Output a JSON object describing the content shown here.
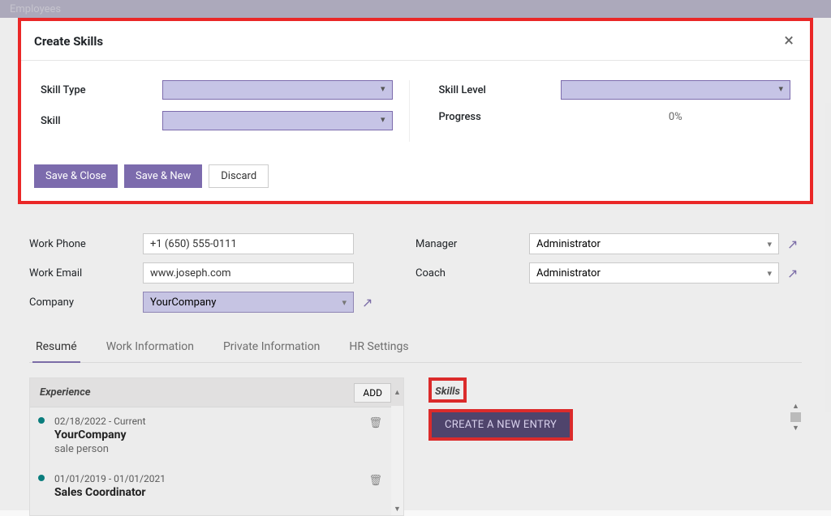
{
  "topbar": {
    "app": "Employees"
  },
  "modal": {
    "title": "Create Skills",
    "close_glyph": "×",
    "fields": {
      "skill_type_label": "Skill Type",
      "skill_label": "Skill",
      "skill_level_label": "Skill Level",
      "progress_label": "Progress",
      "progress_value": "0%"
    },
    "buttons": {
      "save_close": "Save & Close",
      "save_new": "Save & New",
      "discard": "Discard"
    }
  },
  "form": {
    "work_phone_label": "Work Phone",
    "work_phone_value": "+1 (650) 555-0111",
    "work_email_label": "Work Email",
    "work_email_value": "www.joseph.com",
    "company_label": "Company",
    "company_value": "YourCompany",
    "manager_label": "Manager",
    "manager_value": "Administrator",
    "coach_label": "Coach",
    "coach_value": "Administrator"
  },
  "tabs": {
    "resume": "Resumé",
    "work_info": "Work Information",
    "private_info": "Private Information",
    "hr_settings": "HR Settings"
  },
  "experience": {
    "title": "Experience",
    "add": "ADD",
    "items": [
      {
        "date": "02/18/2022 - Current",
        "company": "YourCompany",
        "role": "sale person"
      },
      {
        "date": "01/01/2019 - 01/01/2021",
        "company": "Sales Coordinator",
        "role": ""
      }
    ]
  },
  "skills": {
    "title": "Skills",
    "create": "CREATE A NEW ENTRY"
  },
  "icons": {
    "external": "↗",
    "trash": "🗑",
    "up": "▲",
    "down": "▼"
  }
}
